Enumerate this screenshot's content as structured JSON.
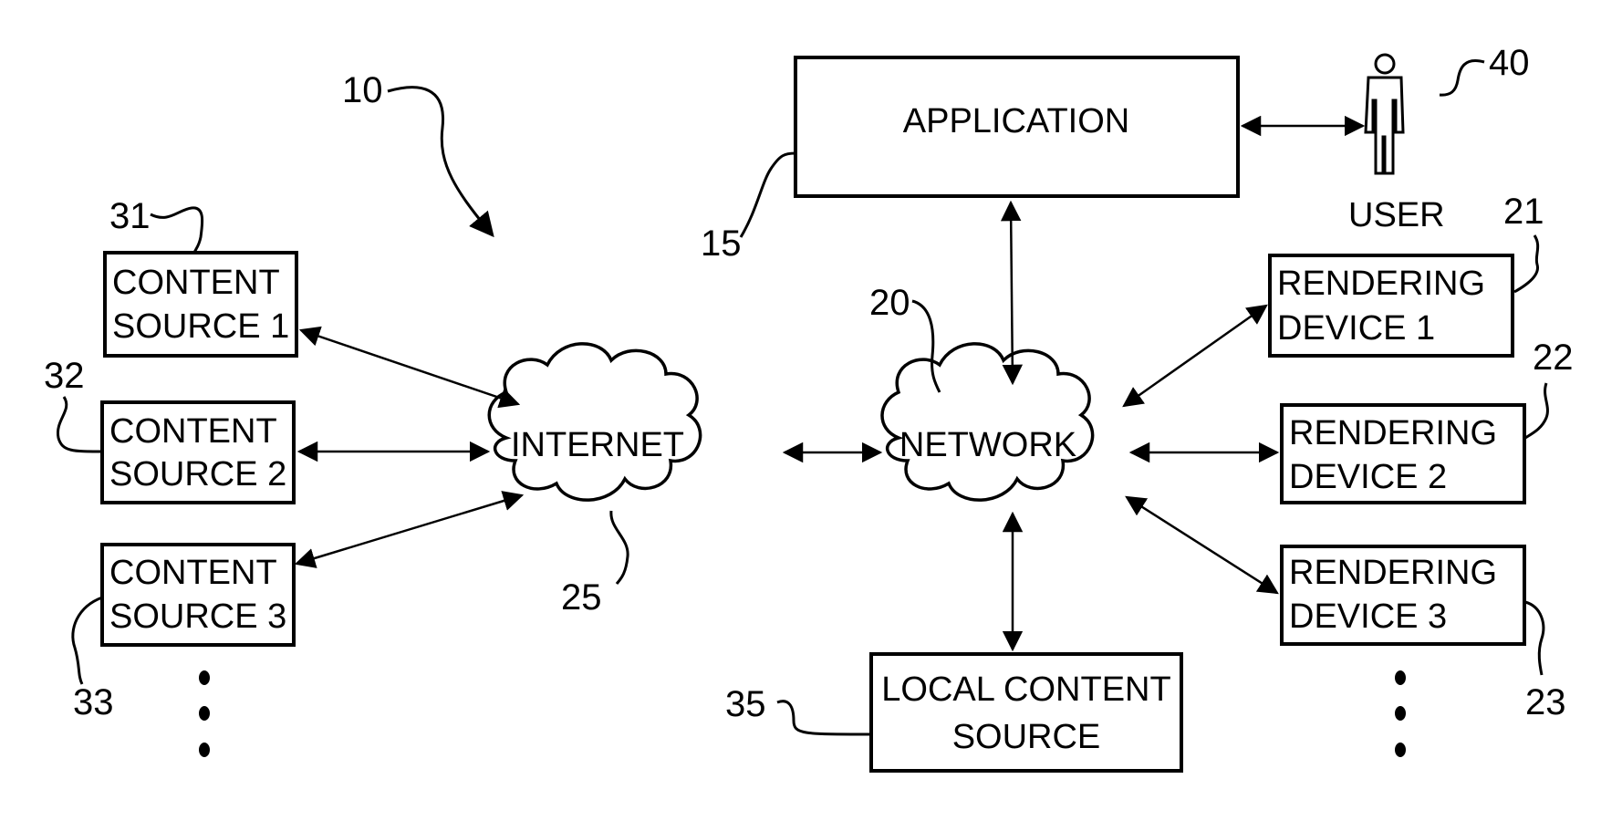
{
  "diagram": {
    "figure_ref": "10",
    "application": {
      "ref": "15",
      "label": "APPLICATION"
    },
    "user": {
      "ref": "40",
      "label": "USER"
    },
    "network": {
      "ref": "20",
      "label": "NETWORK"
    },
    "internet": {
      "ref": "25",
      "label": "INTERNET"
    },
    "local_content_source": {
      "ref": "35",
      "line1": "LOCAL CONTENT",
      "line2": "SOURCE"
    },
    "content_sources": [
      {
        "ref": "31",
        "line1": "CONTENT",
        "line2": "SOURCE 1"
      },
      {
        "ref": "32",
        "line1": "CONTENT",
        "line2": "SOURCE 2"
      },
      {
        "ref": "33",
        "line1": "CONTENT",
        "line2": "SOURCE 3"
      }
    ],
    "rendering_devices": [
      {
        "ref": "21",
        "line1": "RENDERING",
        "line2": "DEVICE 1"
      },
      {
        "ref": "22",
        "line1": "RENDERING",
        "line2": "DEVICE 2"
      },
      {
        "ref": "23",
        "line1": "RENDERING",
        "line2": "DEVICE 3"
      }
    ],
    "continuation": "…"
  }
}
